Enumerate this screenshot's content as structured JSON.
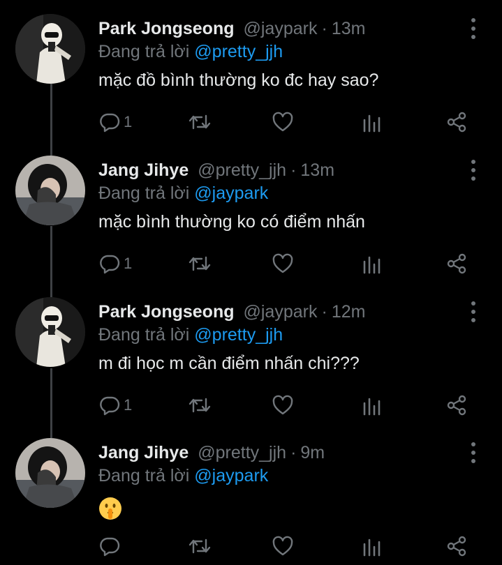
{
  "colors": {
    "background": "#000000",
    "text": "#e7e9ea",
    "muted": "#71767b",
    "link": "#1d9bf0",
    "thread_line": "#3e4144"
  },
  "tweets": [
    {
      "name": "Park Jongseong",
      "handle": "@jaypark",
      "separator": "·",
      "time": "13m",
      "reply_prefix": "Đang trả lời",
      "reply_to": "@pretty_jjh",
      "text": "mặc đồ bình thường ko đc hay sao?",
      "reply_count": "1",
      "avatar_icon": "avatar-photo"
    },
    {
      "name": "Jang Jihye",
      "handle": "@pretty_jjh",
      "separator": "·",
      "time": "13m",
      "reply_prefix": "Đang trả lời",
      "reply_to": "@jaypark",
      "text": "mặc bình thường ko có điểm nhấn",
      "reply_count": "1",
      "avatar_icon": "avatar-photo"
    },
    {
      "name": "Park Jongseong",
      "handle": "@jaypark",
      "separator": "·",
      "time": "12m",
      "reply_prefix": "Đang trả lời",
      "reply_to": "@pretty_jjh",
      "text": "m đi học m cần điểm nhấn chi???",
      "reply_count": "1",
      "avatar_icon": "avatar-photo"
    },
    {
      "name": "Jang Jihye",
      "handle": "@pretty_jjh",
      "separator": "·",
      "time": "9m",
      "reply_prefix": "Đang trả lời",
      "reply_to": "@jaypark",
      "text": "",
      "text_emoji": "shushing-face-emoji",
      "reply_count": "",
      "avatar_icon": "avatar-photo"
    }
  ],
  "action_icons": [
    "reply-icon",
    "retweet-icon",
    "like-icon",
    "analytics-icon",
    "share-icon"
  ]
}
